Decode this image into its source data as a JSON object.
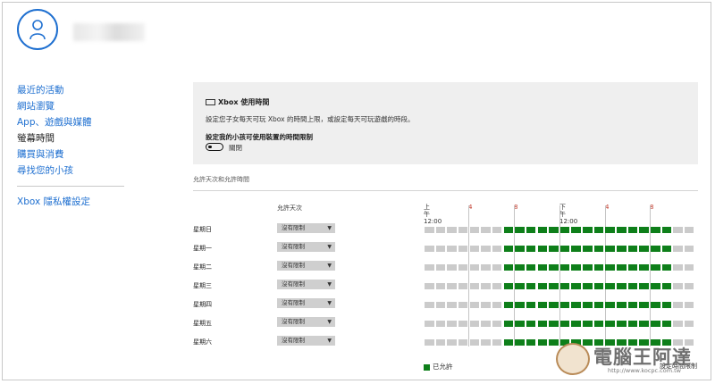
{
  "sidebar": {
    "items": [
      {
        "label": "最近的活動",
        "active": false
      },
      {
        "label": "網站瀏覽",
        "active": false
      },
      {
        "label": "App、遊戲與媒體",
        "active": false
      },
      {
        "label": "螢幕時間",
        "active": true
      },
      {
        "label": "購買與消費",
        "active": false
      },
      {
        "label": "尋找您的小孩",
        "active": false
      }
    ],
    "privacy_link": "Xbox 隱私權設定"
  },
  "panel": {
    "title": "Xbox 使用時間",
    "description": "設定您子女每天可玩 Xbox 的時間上限，或設定每天可玩遊戲的時段。",
    "setting_label": "設定我的小孩可使用裝置的時間限制",
    "toggle_state": "關閉",
    "toggle_on": false
  },
  "schedule": {
    "section_label": "允許天次和允許時間",
    "column_header": "允許天次",
    "timeline_labels": {
      "am_line1": "上",
      "am_line2": "午",
      "am_time": "12:00",
      "h4a": "4",
      "h8a": "8",
      "pm_line1": "下",
      "pm_line2": "午",
      "pm_time": "12:00",
      "h4p": "4",
      "h8p": "8"
    },
    "days": [
      {
        "name": "星期日",
        "limit": "沒有限制"
      },
      {
        "name": "星期一",
        "limit": "沒有限制"
      },
      {
        "name": "星期二",
        "limit": "沒有限制"
      },
      {
        "name": "星期三",
        "limit": "沒有限制"
      },
      {
        "name": "星期四",
        "limit": "沒有限制"
      },
      {
        "name": "星期五",
        "limit": "沒有限制"
      },
      {
        "name": "星期六",
        "limit": "沒有限制"
      }
    ],
    "allowed_hours": {
      "start": 7,
      "end": 22
    },
    "legend_label": "已允許",
    "footer_link": "設定時間限制",
    "colors": {
      "allowed": "#0e7f1a",
      "blocked": "#cbcbcb"
    }
  },
  "watermark": {
    "text": "電腦王阿達",
    "url": "http://www.kocpc.com.tw"
  }
}
